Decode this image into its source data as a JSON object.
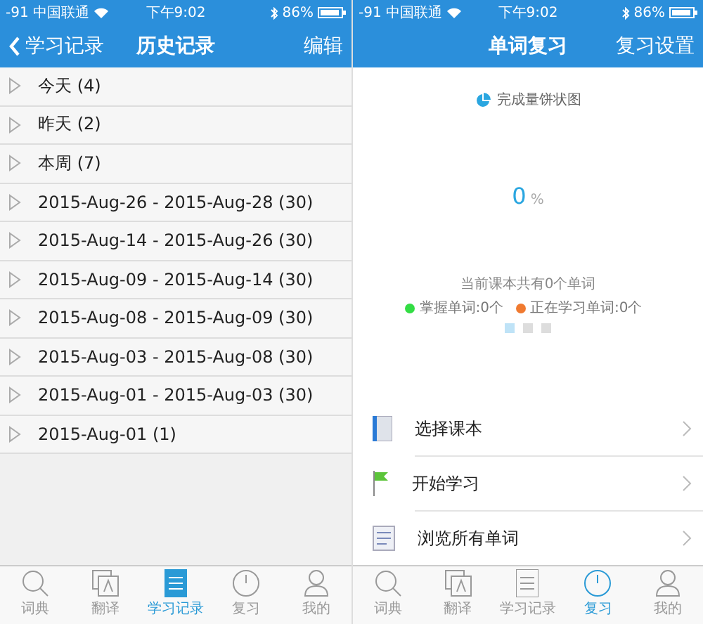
{
  "screens": [
    {
      "status_bar": {
        "signal": "-91 中国联通",
        "time": "下午9:02",
        "battery": "86%"
      },
      "nav": {
        "back": "学习记录",
        "title": "历史记录",
        "action": "编辑"
      },
      "history": [
        {
          "label": "今天 (4)"
        },
        {
          "label": "昨天 (2)"
        },
        {
          "label": "本周 (7)"
        },
        {
          "label": "2015-Aug-26 - 2015-Aug-28 (30)"
        },
        {
          "label": "2015-Aug-14 - 2015-Aug-26 (30)"
        },
        {
          "label": "2015-Aug-09 - 2015-Aug-14 (30)"
        },
        {
          "label": "2015-Aug-08 - 2015-Aug-09 (30)"
        },
        {
          "label": "2015-Aug-03 - 2015-Aug-08 (30)"
        },
        {
          "label": "2015-Aug-01 - 2015-Aug-03 (30)"
        },
        {
          "label": "2015-Aug-01 (1)"
        }
      ],
      "tab_bar": [
        {
          "label": "词典",
          "kind": "search",
          "selected": false
        },
        {
          "label": "翻译",
          "kind": "translate",
          "selected": false
        },
        {
          "label": "学习记录",
          "kind": "notes",
          "selected": true
        },
        {
          "label": "复习",
          "kind": "clock",
          "selected": false
        },
        {
          "label": "我的",
          "kind": "person",
          "selected": false
        }
      ]
    },
    {
      "status_bar": {
        "signal": "-91 中国联通",
        "time": "下午9:02",
        "battery": "86%"
      },
      "nav": {
        "title": "单词复习",
        "action": "复习设置"
      },
      "review": {
        "chart_title": "完成量饼状图",
        "percent": "0",
        "percent_unit": "%",
        "summary": "当前课本共有0个单词",
        "legend": [
          {
            "label": "掌握单词:0个",
            "color": "#33dd44"
          },
          {
            "label": "正在学习单词:0个",
            "color": "#f07a30"
          }
        ],
        "pages": [
          {
            "selected": true
          },
          {
            "selected": false
          },
          {
            "selected": false
          }
        ],
        "menu": [
          {
            "label": "选择课本",
            "kind": "book"
          },
          {
            "label": "开始学习",
            "kind": "flag"
          },
          {
            "label": "浏览所有单词",
            "kind": "list"
          }
        ]
      },
      "tab_bar": [
        {
          "label": "词典",
          "kind": "search",
          "selected": false
        },
        {
          "label": "翻译",
          "kind": "translate",
          "selected": false
        },
        {
          "label": "学习记录",
          "kind": "notes",
          "selected": false
        },
        {
          "label": "复习",
          "kind": "clock",
          "selected": true
        },
        {
          "label": "我的",
          "kind": "person",
          "selected": false
        }
      ]
    }
  ]
}
